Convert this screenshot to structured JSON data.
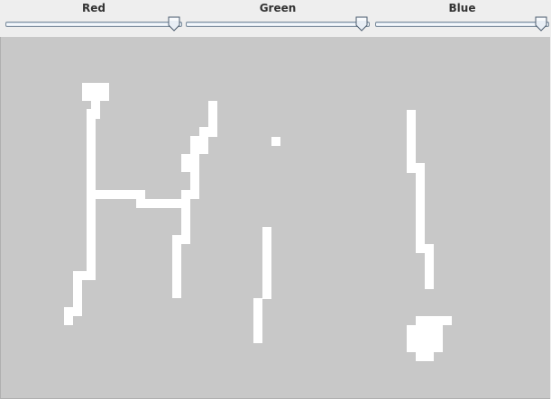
{
  "sliders": [
    {
      "label": "Red",
      "value_fraction": 0.99
    },
    {
      "label": "Green",
      "value_fraction": 0.99
    },
    {
      "label": "Blue",
      "value_fraction": 0.99
    }
  ],
  "colors": {
    "canvas_background": "#c8c8c8",
    "stroke_color": "#ffffff",
    "panel_background": "#eeeeee"
  }
}
